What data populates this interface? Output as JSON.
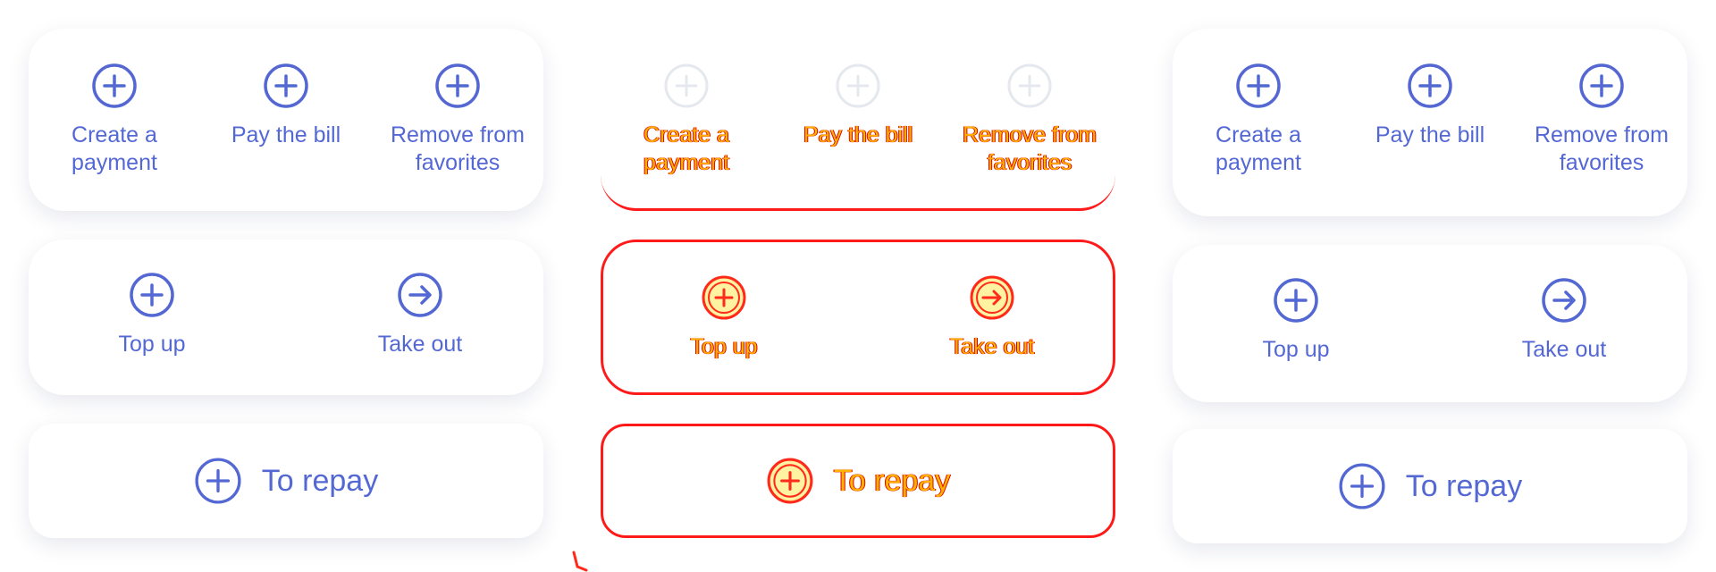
{
  "actions": [
    {
      "label": "Create a payment",
      "icon": "plus-circle-icon"
    },
    {
      "label": "Pay the bill",
      "icon": "plus-circle-icon"
    },
    {
      "label": "Remove from favorites",
      "icon": "plus-circle-icon"
    }
  ],
  "transfers": [
    {
      "label": "Top up",
      "icon": "plus-circle-icon"
    },
    {
      "label": "Take out",
      "icon": "arrow-right-circle-icon"
    }
  ],
  "repay": {
    "label": "To repay",
    "icon": "plus-circle-icon"
  },
  "colors": {
    "accent": "#5468d4",
    "highlight_red": "#ff1a1a",
    "highlight_yellow": "#ffb300"
  }
}
